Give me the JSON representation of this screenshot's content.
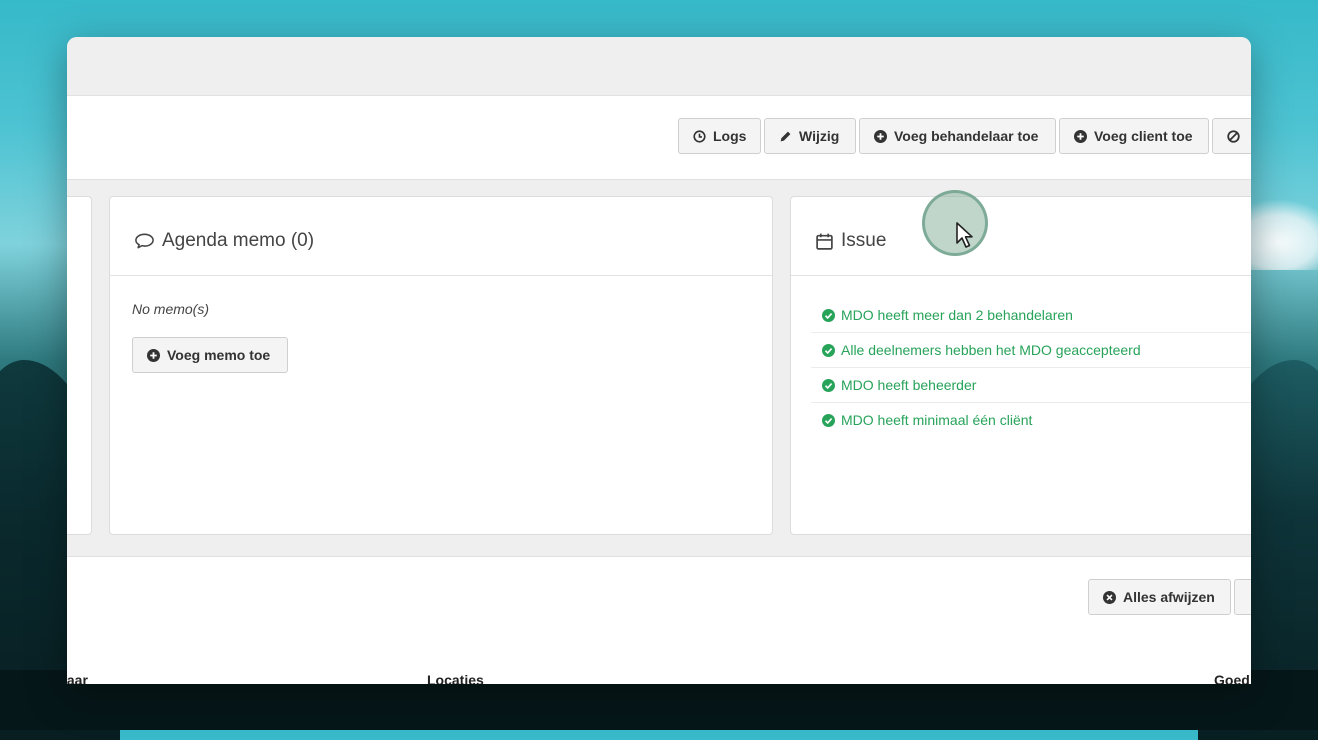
{
  "toolbar": {
    "logs": "Logs",
    "edit": "Wijzig",
    "add_practitioner": "Voeg behandelaar toe",
    "add_client": "Voeg client toe"
  },
  "memo_panel": {
    "title": "Agenda memo (0)",
    "empty_text": "No memo(s)",
    "add_button": "Voeg memo toe"
  },
  "issue_panel": {
    "title": "Issue",
    "items": [
      "MDO heeft meer dan 2 behandelaren",
      "Alle deelnemers hebben het MDO geaccepteerd",
      "MDO heeft beheerder",
      "MDO heeft minimaal één cliënt"
    ],
    "status_color": "#27a35a"
  },
  "footer": {
    "reject_all": "Alles afwijzen"
  },
  "table": {
    "columns": [
      "laar",
      "Locaties",
      "Goed"
    ]
  },
  "icons": {
    "logs": "clock-icon",
    "edit": "pencil-icon",
    "add": "plus-circle-icon",
    "ban": "ban-icon",
    "memo": "comment-icon",
    "issue": "calendar-icon",
    "issue_item": "check-circle-icon",
    "reject": "times-circle-icon",
    "cursor": "mouse-pointer-icon"
  }
}
